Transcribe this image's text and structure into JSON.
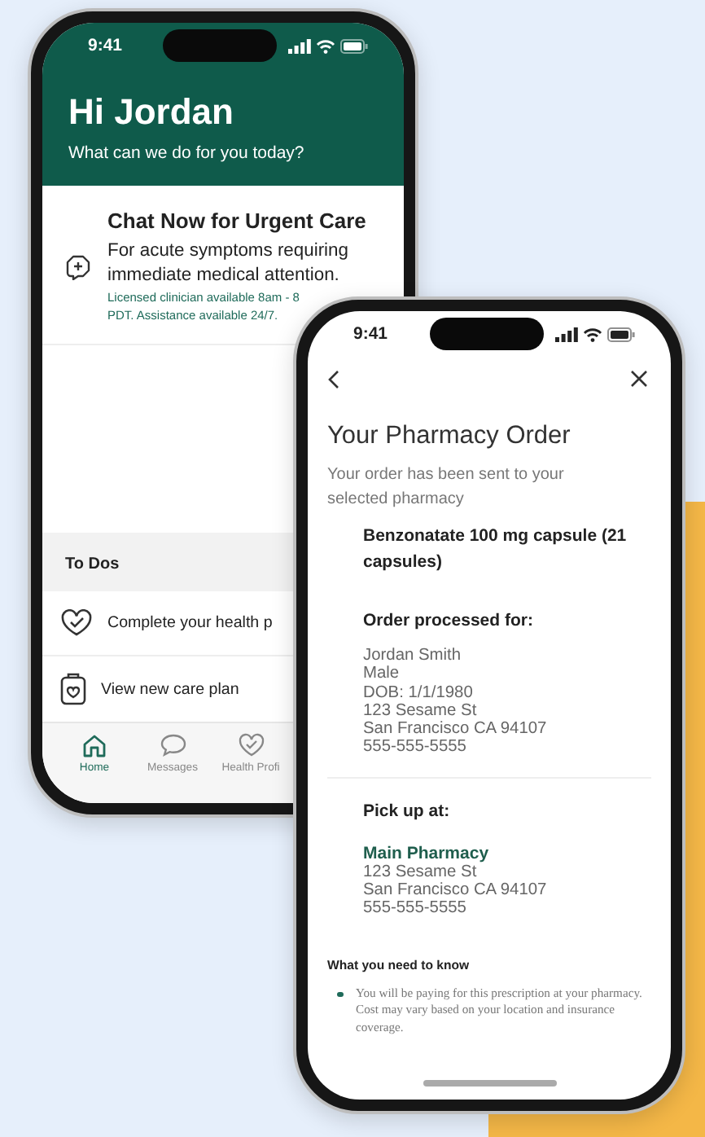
{
  "home_phone": {
    "status_time": "9:41",
    "greeting": "Hi Jordan",
    "subtitle": "What can we do for you today?",
    "urgent_card": {
      "title": "Chat Now for Urgent Care",
      "description": "For acute symptoms requiring immediate medical attention.",
      "note_lines": [
        "Licensed clinician available 8am - 8",
        "PDT. Assistance available 24/7."
      ]
    },
    "section_title": "To Dos",
    "todos": [
      {
        "kind": "health-profile",
        "label": "Complete your health p"
      },
      {
        "kind": "care-plan",
        "label": "View new care plan"
      }
    ],
    "tabs": [
      {
        "kind": "home",
        "label": "Home",
        "selected": true
      },
      {
        "kind": "messages",
        "label": "Messages",
        "selected": false
      },
      {
        "kind": "health",
        "label": "Health Profi",
        "selected": false
      }
    ]
  },
  "order_phone": {
    "status_time": "9:41",
    "title": "Your Pharmacy Order",
    "subtitle": "Your order has been sent to your selected pharmacy",
    "medication": "Benzonatate 100 mg capsule (21 capsules)",
    "patient": {
      "heading": "Order processed for:",
      "lines": [
        "Jordan Smith",
        "Male",
        "DOB: 1/1/1980",
        "123 Sesame St",
        "San Francisco CA 94107",
        "555-555-5555"
      ]
    },
    "pickup": {
      "heading": "Pick up at:",
      "pharmacy": "Main Pharmacy",
      "lines": [
        "123 Sesame St",
        "San Francisco CA 94107",
        "555-555-5555"
      ]
    },
    "notice": {
      "heading": "What you need to know",
      "items": [
        "You will be paying for this prescription at your pharmacy. Cost may vary based on your location and insurance coverage."
      ]
    }
  }
}
